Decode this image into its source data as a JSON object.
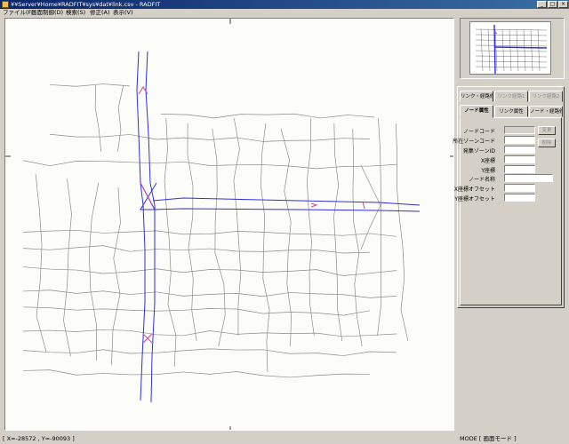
{
  "window": {
    "title": "¥¥Server¥Home¥RADFIT¥sys¥dat¥link.csv - RADFIT",
    "minimize": "_",
    "maximize": "□",
    "close": "×"
  },
  "menu": [
    {
      "label": "ファイル(F)"
    },
    {
      "label": "画面制御(D)"
    },
    {
      "label": "検索(S)"
    },
    {
      "label": "修正(A)"
    },
    {
      "label": "表示(V)"
    }
  ],
  "tabs_row1": [
    {
      "label": "リンク・経路修正",
      "state": "normal"
    },
    {
      "label": "リンク経路1",
      "state": "disabled"
    },
    {
      "label": "リンク経路2",
      "state": "disabled"
    }
  ],
  "tabs_row2": [
    {
      "label": "ノード属性",
      "state": "active"
    },
    {
      "label": "リンク属性",
      "state": "normal"
    },
    {
      "label": "ノード・経路修正",
      "state": "normal"
    }
  ],
  "node_fields": [
    {
      "label": "ノードコード",
      "value": "",
      "readonly": true
    },
    {
      "label": "所在ゾーンコード",
      "value": "",
      "readonly": false
    },
    {
      "label": "発集ゾーンID",
      "value": "",
      "readonly": false
    },
    {
      "label": "X座標",
      "value": "",
      "readonly": false
    },
    {
      "label": "Y座標",
      "value": "",
      "readonly": false
    },
    {
      "label": "ノード名称",
      "value": "",
      "readonly": false,
      "wide": true
    },
    {
      "label": "X座標オフセット",
      "value": "",
      "readonly": false
    },
    {
      "label": "Y座標オフセット",
      "value": "",
      "readonly": false
    }
  ],
  "buttons": {
    "change": "変更",
    "delete": "削除"
  },
  "status": {
    "coords": "[ X=-28572 , Y=-90093 ]",
    "mode": "MODE [ 画面モード ]"
  },
  "colors": {
    "road": "#8c8c8c",
    "route": "#3030d8",
    "node_marker": "#d040a0",
    "map_bg": "#fcfcf8"
  }
}
